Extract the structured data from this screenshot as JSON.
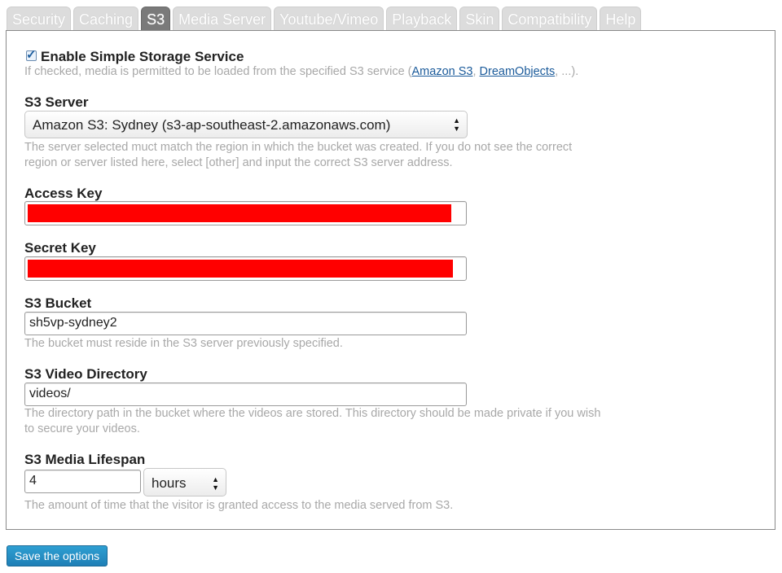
{
  "tabs": [
    {
      "label": "Security"
    },
    {
      "label": "Caching"
    },
    {
      "label": "S3"
    },
    {
      "label": "Media Server"
    },
    {
      "label": "Youtube/Vimeo"
    },
    {
      "label": "Playback"
    },
    {
      "label": "Skin"
    },
    {
      "label": "Compatibility"
    },
    {
      "label": "Help"
    }
  ],
  "active_tab": "S3",
  "enable": {
    "label": "Enable Simple Storage Service",
    "checked": true,
    "desc_prefix": "If checked, media is permitted to be loaded from the specified S3 service (",
    "link1": "Amazon S3",
    "sep": ", ",
    "link2": "DreamObjects",
    "desc_suffix": ", ...)."
  },
  "server": {
    "label": "S3 Server",
    "value": "Amazon S3: Sydney (s3-ap-southeast-2.amazonaws.com)",
    "desc_line1": "The server selected muct match the region in which the bucket was created. If you do not see the correct",
    "desc_line2": "region or server listed here, select [other] and input the correct S3 server address."
  },
  "access_key": {
    "label": "Access Key",
    "redacted": true
  },
  "secret_key": {
    "label": "Secret Key",
    "redacted": true
  },
  "bucket": {
    "label": "S3 Bucket",
    "value": "sh5vp-sydney2",
    "desc": "The bucket must reside in the S3 server previously specified."
  },
  "video_dir": {
    "label": "S3 Video Directory",
    "value": "videos/",
    "desc_line1": "The directory path in the bucket where the videos are stored. This directory should be made private if you wish",
    "desc_line2": "to secure your videos."
  },
  "lifespan": {
    "label": "S3 Media Lifespan",
    "value": "4",
    "unit": "hours",
    "desc": "The amount of time that the visitor is granted access to the media served from S3."
  },
  "save_label": "Save the options",
  "colors": {
    "accent": "#2a8fc7",
    "redaction": "#ff0000"
  }
}
